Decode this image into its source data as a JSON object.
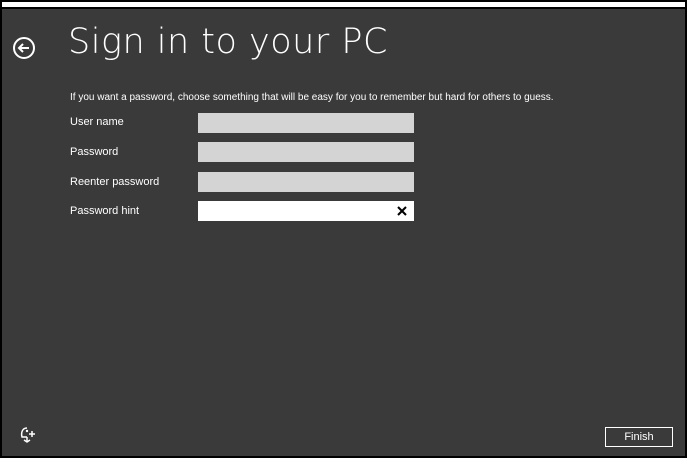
{
  "header": {
    "title": "Sign in to your PC"
  },
  "instructions": "If you want a password, choose something that will be easy for you to remember but hard for others to guess.",
  "form": {
    "username": {
      "label": "User name",
      "value": ""
    },
    "password": {
      "label": "Password",
      "value": ""
    },
    "reenter_password": {
      "label": "Reenter password",
      "value": ""
    },
    "password_hint": {
      "label": "Password hint",
      "value": ""
    }
  },
  "footer": {
    "finish_label": "Finish"
  },
  "icons": {
    "back": "back-arrow-icon",
    "clear": "close-icon",
    "ease_of_access": "ease-of-access-icon"
  },
  "colors": {
    "background": "#3a3a3a",
    "text": "#ffffff",
    "input_disabled": "#d4d4d4",
    "input_active": "#ffffff"
  }
}
